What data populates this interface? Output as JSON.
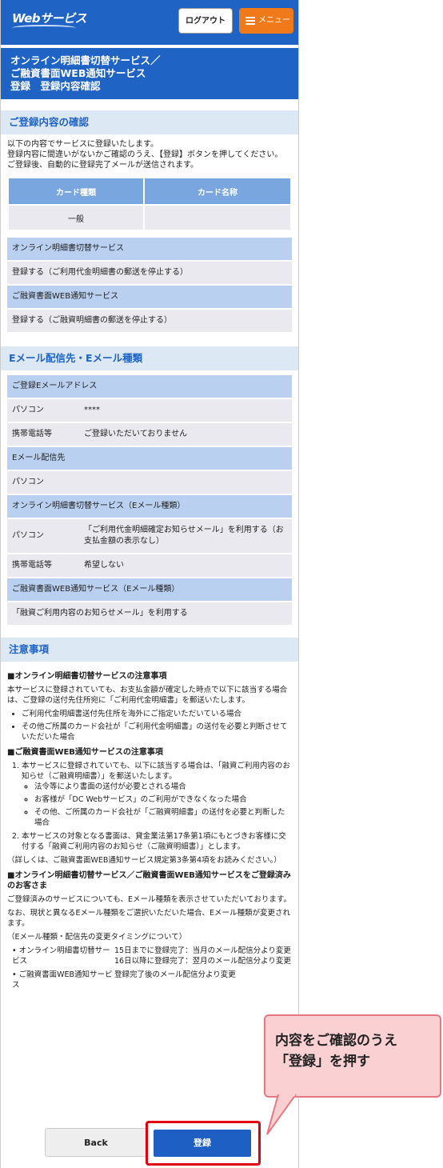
{
  "header": {
    "logo": "Webサービス",
    "logout_label": "ログアウト",
    "menu_label": "メニュー"
  },
  "title_lines": [
    "オンライン明細書切替サービス／",
    "ご融資書面WEB通知サービス",
    "登録　登録内容確認"
  ],
  "confirm": {
    "heading": "ご登録内容の確認",
    "intro": [
      "以下の内容でサービスに登録いたします。",
      "登録内容に間違いがないかご確認のうえ、【登録】ボタンを押してください。",
      "ご登録後、自動的に登録完了メールが送信されます。"
    ],
    "card_table": {
      "headers": [
        "カード種類",
        "カード名称"
      ],
      "rows": [
        [
          "一般",
          ""
        ]
      ]
    },
    "services": [
      {
        "label": "オンライン明細書切替サービス",
        "value": "登録する（ご利用代金明細書の郵送を停止する）"
      },
      {
        "label": "ご融資書面WEB通知サービス",
        "value": "登録する（ご融資明細書の郵送を停止する）"
      }
    ]
  },
  "email": {
    "heading": "Eメール配信先・Eメール種類",
    "registered_label": "ご登録Eメールアドレス",
    "pc_key": "パソコン",
    "pc_val": "****",
    "mobile_key": "携帯電話等",
    "mobile_val": "ご登録いただいておりません",
    "dest_label": "Eメール配信先",
    "dest_val": "パソコン",
    "online_label": "オンライン明細書切替サービス（Eメール種類）",
    "online_pc_key": "パソコン",
    "online_pc_val": "「ご利用代金明細確定お知らせメール」を利用する（お支払金額の表示なし）",
    "online_mobile_key": "携帯電話等",
    "online_mobile_val": "希望しない",
    "loan_label": "ご融資書面WEB通知サービス（Eメール種類）",
    "loan_val": "「融資ご利用内容のお知らせメール」を利用する"
  },
  "notes": {
    "heading": "注意事項",
    "h1": "■オンライン明細書切替サービスの注意事項",
    "p1": "本サービスに登録されていても、お支払金額が確定した時点で以下に該当する場合は、ご登録の送付先住所宛に「ご利用代金明細書」を郵送いたします。",
    "l1": [
      "ご利用代金明細書送付先住所を海外にご指定いただいている場合",
      "その他ご所属のカード会社が「ご利用代金明細書」の送付を必要と判断させていただいた場合"
    ],
    "h2": "■ご融資書面WEB通知サービスの注意事項",
    "o1": "本サービスに登録されていても、以下に該当する場合は、「融資ご利用内容のお知らせ（ご融資明細書）」を郵送いたします。",
    "o1_list": [
      "法令等により書面の送付が必要とされる場合",
      "お客様が「DC Webサービス」のご利用ができなくなった場合",
      "その他、ご所属のカード会社が「ご融資明細書」の送付を必要と判断した場合"
    ],
    "o2": "本サービスの対象となる書面は、貸金業法第17条第1項にもとづきお客様に交付する「融資ご利用内容のお知らせ（ご融資明細書）」とします。",
    "p2": "（詳しくは、ご融資書面WEB通知サービス規定第3条第4項をお読みください。）",
    "h3": "■オンライン明細書切替サービス／ご融資書面WEB通知サービスをご登録済みのお客さま",
    "p3": "ご登録済みのサービスについても、Eメール種類を表示させていただいております。",
    "p4": "なお、現状と異なるEメール種類をご選択いただいた場合、Eメール種類が変更されます。",
    "p5": "（Eメール種類・配信先の変更タイミングについて）",
    "t1_key": "オンライン明細書切替サービス",
    "t1_val": "15日までに登録完了：当月のメール配信分より変更　16日以降に登録完了：翌月のメール配信分より変更",
    "t2_key": "ご融資書面WEB通知サービス",
    "t2_val": "登録完了後のメール配信分より変更"
  },
  "buttons": {
    "back": "Back",
    "register": "登録"
  },
  "callout": {
    "line1": "内容をご確認のうえ",
    "line2": "「登録」を押す"
  },
  "colors": {
    "brand_blue": "#1f63c4",
    "accent_orange": "#f07a1a",
    "highlight_red": "#e00010",
    "callout_pink": "#fad0d3"
  }
}
